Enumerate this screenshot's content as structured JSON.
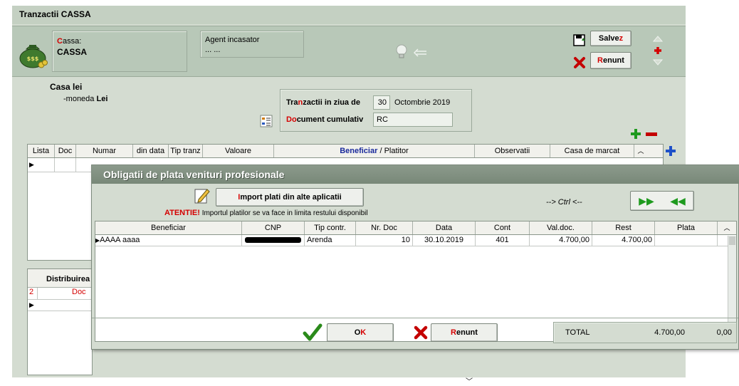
{
  "main": {
    "title": "Tranzactii CASSA",
    "cassa_label_first": "C",
    "cassa_label_rest": "assa:",
    "cassa_value": "CASSA",
    "agent_label": "Agent incasator",
    "agent_value": "... ...",
    "save_first": "Salve",
    "save_last": "z",
    "cancel_first": "R",
    "cancel_rest": "enunt",
    "casa_title": "Casa lei",
    "moneda_label": "-moneda",
    "moneda_value": "Lei",
    "tranz_label_a": "Tra",
    "tranz_label_b": "n",
    "tranz_label_c": "zactii in ziua de",
    "day": "30",
    "month_year": "Octombrie 2019",
    "doc_label_a": "D",
    "doc_label_b": "o",
    "doc_label_c": "cument cumulativ",
    "doc_value": "RC",
    "grid_headers": [
      "Lista",
      "Doc",
      "Numar",
      "din data",
      "Tip tranz",
      "Valoare",
      "Beneficiar",
      "/ Platitor",
      "Observatii",
      "Casa de marcat"
    ],
    "distrib_label": "Distribuirea",
    "distrib_row_num": "2",
    "distrib_row_doc": "Doc"
  },
  "dialog": {
    "title": "Obligatii de plata venituri profesionale",
    "import_first": "I",
    "import_rest": "mport plati din alte aplicatii",
    "warning_strong": "ATENTIE!",
    "warning_text": "Importul platilor se va face in limita restului disponibil",
    "ctrl_hint": "--> Ctrl <--",
    "columns": [
      "Beneficiar",
      "CNP",
      "Tip contr.",
      "Nr. Doc",
      "Data",
      "Cont",
      "Val.doc.",
      "Rest",
      "Plata"
    ],
    "rows": [
      {
        "beneficiar": "AAAA aaaa",
        "cnp": "",
        "tip": "Arenda",
        "nr_doc": "10",
        "data": "30.10.2019",
        "cont": "401",
        "val_doc": "4.700,00",
        "rest": "4.700,00",
        "plata": ""
      }
    ],
    "ok_label": "OK",
    "ok_first": "O",
    "ok_rest": "K",
    "renunt_first": "R",
    "renunt_rest": "enunt",
    "total_label": "TOTAL",
    "total_value": "4.700,00",
    "total_plata": "0,00"
  },
  "colors": {
    "accent_red": "#d40000",
    "grid_header_blue": "#1a2a9c",
    "panel": "#d4dcd1"
  }
}
